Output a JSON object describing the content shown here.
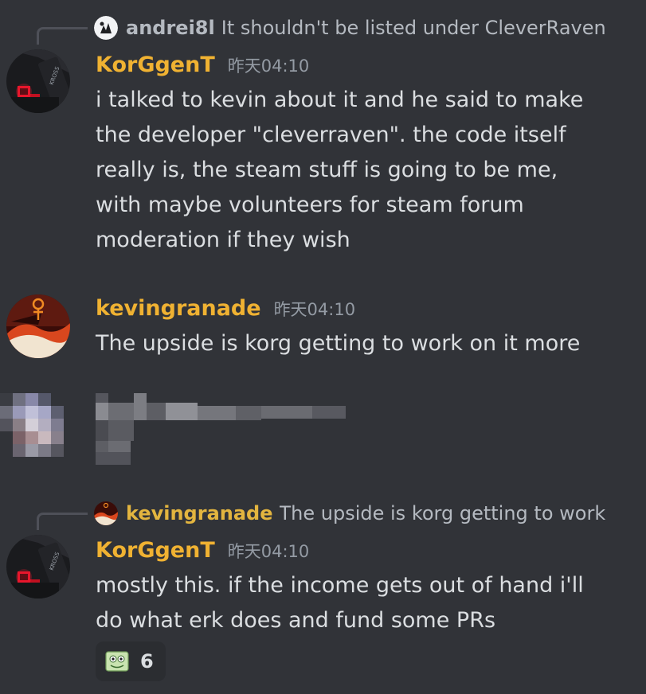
{
  "messages": [
    {
      "reply": {
        "author": "andrei8l",
        "text": "It shouldn't be listed under CleverRaven"
      },
      "author": "KorGgenT",
      "timestamp": "昨天04:10",
      "lines": [
        "i talked to kevin about it and he said to make",
        "the developer \"cleverraven\". the code itself",
        "really is, the steam stuff is going to be me,",
        "with maybe volunteers for steam forum",
        "moderation if they wish"
      ]
    },
    {
      "author": "kevingranade",
      "timestamp": "昨天04:10",
      "lines": [
        "The upside is korg getting to work on it more"
      ]
    },
    {
      "reply": {
        "author": "kevingranade",
        "text": "The upside is korg getting to work on it more"
      },
      "author": "KorGgenT",
      "timestamp": "昨天04:10",
      "lines": [
        "mostly this. if the income gets out of hand i'll",
        "do what erk does and fund some PRs"
      ],
      "reaction": {
        "emoji": "frog-emoji",
        "count": "6"
      }
    }
  ],
  "colors": {
    "background": "#313338",
    "username": "#f0b232",
    "text": "#dbdee1",
    "muted": "#949ba4"
  }
}
